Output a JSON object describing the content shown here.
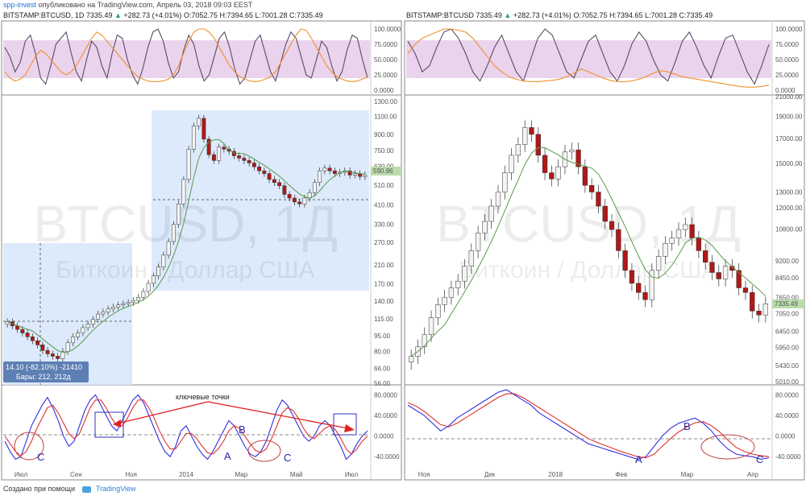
{
  "header": {
    "user": "spp-invest",
    "published": "опубликовано на TradingView.com, Апрель 03, 2018 09:03 EEST"
  },
  "left": {
    "symbol": "BITSTAMP:BTCUSD, 1D",
    "price": "7335.49",
    "change_arrow": "▲",
    "change": "+282.73 (+4.01%)",
    "ohlc": "O:7052.75 H:7394.65 L:7001.28 C:7335.49"
  },
  "right": {
    "symbol": "BITSTAMP:BTCUSD",
    "price": "7335.49",
    "change_arrow": "▲",
    "change": "+282.73 (+4.01%)",
    "ohlc": "O:7052.75 H:7394.65 L:7001.28 C:7335.49"
  },
  "watermark": {
    "line1": "BTCUSD, 1Д",
    "line2": "Биткоин / Доллар США"
  },
  "footer": {
    "text": "Создано при помощи",
    "brand": "TradingView"
  },
  "annotations": {
    "key_points": "ключевые точки",
    "left_labels": [
      "C",
      "B",
      "A",
      "C"
    ],
    "right_labels": [
      "B",
      "A",
      "C"
    ]
  },
  "tooltip": {
    "line1": "14.10 (-82.10%) -21410",
    "line2": "Бары: 212, 212д"
  },
  "chart_data": [
    {
      "type": "line",
      "panel": "left-stochrsi",
      "y_ticks": [
        "100.0000",
        "75.0000",
        "50.0000",
        "25.0000",
        "0.0000"
      ],
      "ylim": [
        0,
        100
      ],
      "band": [
        20,
        80
      ],
      "series": [
        {
          "color": "#5a4a6a",
          "values": [
            70,
            55,
            30,
            45,
            80,
            90,
            60,
            20,
            10,
            40,
            75,
            85,
            95,
            60,
            30,
            15,
            50,
            80,
            70,
            40,
            20,
            60,
            90,
            85,
            50,
            25,
            10,
            35,
            70,
            95,
            100,
            80,
            45,
            20,
            30,
            65,
            90,
            75,
            40,
            15,
            25,
            55,
            85,
            95,
            70,
            35,
            10,
            20,
            50,
            80,
            90,
            60,
            30,
            15,
            45,
            75,
            95,
            85,
            55,
            25,
            20,
            50,
            80,
            70,
            40,
            15,
            30,
            65,
            90,
            85,
            50,
            20
          ]
        },
        {
          "color": "#f0902e",
          "values": [
            30,
            20,
            15,
            18,
            25,
            40,
            55,
            65,
            60,
            50,
            40,
            30,
            25,
            30,
            40,
            55,
            70,
            85,
            95,
            90,
            80,
            70,
            60,
            50,
            40,
            30,
            22,
            18,
            15,
            14,
            14,
            15,
            18,
            25,
            40,
            60,
            80,
            95,
            100,
            100,
            95,
            85,
            70,
            55,
            40,
            30,
            22,
            18,
            15,
            14,
            15,
            18,
            22,
            30,
            45,
            60,
            75,
            90,
            100,
            98,
            85,
            70,
            55,
            40,
            30,
            22,
            18,
            15,
            14,
            15,
            18,
            22
          ]
        }
      ]
    },
    {
      "type": "candlestick",
      "panel": "left-price",
      "y_scale": "log",
      "y_ticks": [
        "1300.00",
        "1100.00",
        "900.00",
        "750.00",
        "630.00",
        "510.00",
        "410.00",
        "330.00",
        "270.00",
        "210.00",
        "170.00",
        "140.00",
        "115.00",
        "95.00",
        "80.00",
        "66.00",
        "56.00"
      ],
      "ylim": [
        56,
        1300
      ],
      "last_value": "590.96",
      "x_labels": [
        "Июл",
        "Сен",
        "Ноя",
        "2014",
        "Мар",
        "Май",
        "Июл"
      ],
      "close": [
        105,
        100,
        96,
        92,
        88,
        84,
        80,
        75,
        72,
        70,
        68,
        74,
        82,
        88,
        92,
        98,
        102,
        108,
        115,
        118,
        122,
        125,
        128,
        130,
        132,
        135,
        140,
        150,
        165,
        180,
        200,
        230,
        270,
        330,
        420,
        560,
        800,
        1050,
        1150,
        900,
        750,
        700,
        820,
        800,
        780,
        740,
        720,
        700,
        680,
        650,
        620,
        600,
        560,
        540,
        520,
        470,
        450,
        430,
        420,
        450,
        480,
        540,
        620,
        640,
        620,
        600,
        610,
        620,
        590,
        600,
        580,
        590
      ]
    },
    {
      "type": "line",
      "panel": "left-macd",
      "y_ticks": [
        "80.0000",
        "40.0000",
        "0.0000",
        "-40.0000"
      ],
      "ylim": [
        -60,
        90
      ],
      "series": [
        {
          "color": "#2f2fe0",
          "values": [
            -10,
            -30,
            -45,
            -40,
            -10,
            20,
            40,
            60,
            75,
            55,
            30,
            0,
            -20,
            -10,
            20,
            50,
            70,
            80,
            60,
            40,
            20,
            10,
            30,
            50,
            70,
            80,
            65,
            40,
            15,
            -10,
            -30,
            -40,
            -20,
            10,
            20,
            0,
            -20,
            -35,
            -45,
            -30,
            -10,
            10,
            30,
            20,
            0,
            -20,
            -35,
            -40,
            -30,
            -10,
            20,
            50,
            70,
            60,
            40,
            20,
            0,
            -10,
            0,
            20,
            30,
            20,
            0,
            -20,
            -45,
            -35,
            -15,
            0,
            10
          ]
        },
        {
          "color": "#e03030",
          "values": [
            0,
            -15,
            -30,
            -38,
            -30,
            -10,
            15,
            35,
            55,
            60,
            45,
            25,
            5,
            -5,
            5,
            30,
            55,
            70,
            70,
            55,
            35,
            20,
            20,
            35,
            55,
            70,
            70,
            55,
            35,
            10,
            -10,
            -25,
            -25,
            -10,
            5,
            5,
            -5,
            -20,
            -32,
            -35,
            -25,
            -10,
            10,
            20,
            15,
            0,
            -15,
            -28,
            -32,
            -25,
            -5,
            20,
            45,
            55,
            50,
            35,
            15,
            0,
            -5,
            5,
            15,
            20,
            12,
            -5,
            -25,
            -35,
            -25,
            -10,
            0
          ]
        }
      ]
    },
    {
      "type": "line",
      "panel": "right-stochrsi",
      "y_ticks": [
        "100.0000",
        "75.0000",
        "50.0000",
        "25.0000",
        "0.0000"
      ],
      "ylim": [
        0,
        100
      ],
      "band": [
        20,
        80
      ],
      "series": [
        {
          "color": "#5a4a6a",
          "values": [
            80,
            60,
            30,
            40,
            70,
            95,
            100,
            85,
            60,
            30,
            15,
            40,
            70,
            90,
            60,
            30,
            15,
            50,
            85,
            100,
            90,
            60,
            30,
            20,
            50,
            80,
            90,
            60,
            30,
            15,
            40,
            75,
            95,
            80,
            50,
            25,
            15,
            45,
            80,
            95,
            70,
            40,
            20,
            55,
            85,
            90,
            60,
            30,
            10,
            40,
            75
          ]
        },
        {
          "color": "#f0902e",
          "values": [
            60,
            75,
            85,
            90,
            95,
            100,
            100,
            98,
            95,
            85,
            70,
            55,
            40,
            30,
            22,
            18,
            15,
            14,
            14,
            15,
            16,
            18,
            22,
            28,
            35,
            30,
            25,
            20,
            16,
            14,
            14,
            15,
            18,
            22,
            28,
            32,
            30,
            26,
            22,
            20,
            18,
            16,
            14,
            12,
            10,
            8,
            6,
            5,
            5,
            6,
            8
          ]
        }
      ]
    },
    {
      "type": "candlestick",
      "panel": "right-price",
      "y_scale": "log",
      "y_ticks": [
        "21000.00",
        "19000.00",
        "17000.00",
        "15000.00",
        "13000.00",
        "12000.00",
        "10800.00",
        "9200.00",
        "8450.00",
        "7650.00",
        "7050.00",
        "6450.00",
        "5950.00",
        "5430.00",
        "5010.00"
      ],
      "ylim": [
        5010,
        21000
      ],
      "last_value": "7335.49",
      "x_labels": [
        "Ноя",
        "Дек",
        "2018",
        "Фев",
        "Мар",
        "Апр"
      ],
      "close": [
        5500,
        5800,
        6200,
        6800,
        7300,
        7600,
        8000,
        8300,
        9000,
        9800,
        10800,
        11500,
        12500,
        13500,
        15000,
        16500,
        17500,
        19200,
        18500,
        16500,
        15000,
        14500,
        15500,
        16800,
        17000,
        15500,
        14000,
        13500,
        12500,
        11500,
        11000,
        9800,
        8800,
        8200,
        7800,
        7500,
        8800,
        9500,
        10200,
        10500,
        11000,
        11300,
        10500,
        9800,
        9200,
        8700,
        8400,
        9000,
        8800,
        8000,
        7800,
        7050,
        6900,
        7335
      ]
    },
    {
      "type": "line",
      "panel": "right-macd",
      "y_ticks": [
        "80.0000",
        "40.0000",
        "0.0000",
        "-40.0000"
      ],
      "ylim": [
        -60,
        90
      ],
      "series": [
        {
          "color": "#2f2fe0",
          "values": [
            60,
            50,
            40,
            25,
            10,
            20,
            35,
            45,
            55,
            65,
            75,
            85,
            90,
            80,
            70,
            60,
            45,
            35,
            25,
            15,
            5,
            -5,
            -15,
            -20,
            -25,
            -30,
            -35,
            -40,
            -45,
            -40,
            -20,
            0,
            15,
            25,
            30,
            35,
            25,
            10,
            -10,
            -25,
            -35,
            -38,
            -40,
            -45,
            -42
          ]
        },
        {
          "color": "#e03030",
          "values": [
            65,
            58,
            48,
            35,
            22,
            18,
            25,
            35,
            45,
            55,
            65,
            75,
            82,
            82,
            75,
            65,
            55,
            45,
            35,
            25,
            15,
            5,
            -5,
            -12,
            -18,
            -24,
            -30,
            -35,
            -40,
            -42,
            -35,
            -20,
            -5,
            8,
            18,
            26,
            28,
            20,
            8,
            -8,
            -22,
            -30,
            -35,
            -38,
            -40
          ]
        }
      ]
    }
  ]
}
